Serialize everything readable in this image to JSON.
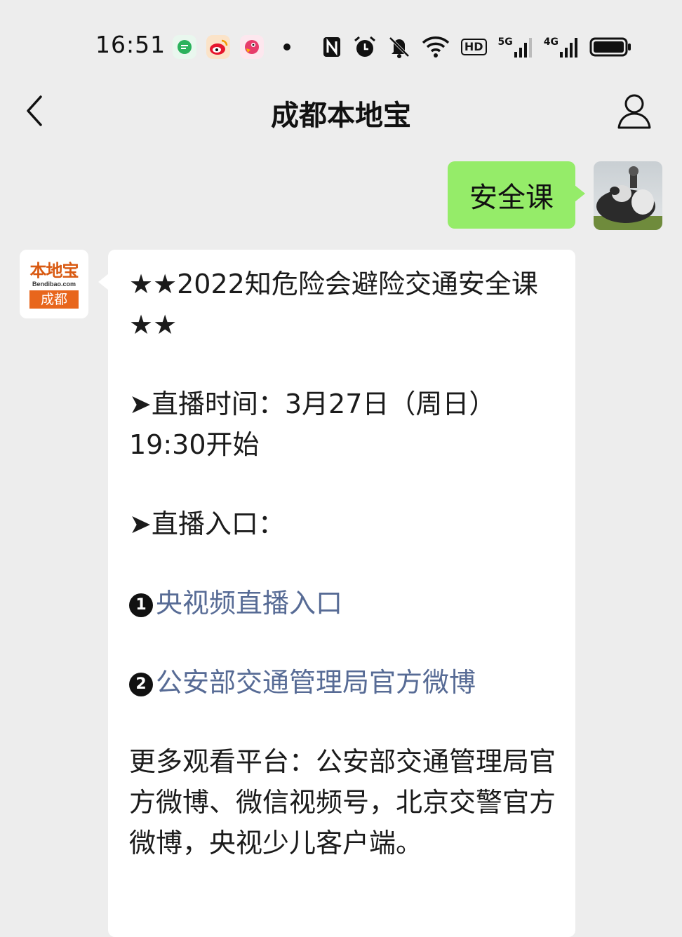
{
  "status_bar": {
    "time": "16:51",
    "app_icons": [
      "chat-bubble-icon",
      "weibo-icon",
      "bird-app-icon"
    ],
    "indicators": [
      "nfc-icon",
      "alarm-icon",
      "mute-icon",
      "wifi-icon",
      "hd-icon",
      "signal-5g-icon",
      "signal-4g-icon",
      "battery-icon"
    ],
    "hd_label": "HD",
    "net1": "5G",
    "net2": "4G"
  },
  "nav": {
    "title": "成都本地宝"
  },
  "outgoing_message": {
    "text": "安全课"
  },
  "bendibao_avatar": {
    "logo_top": "本地宝",
    "logo_mid": "Bendibao.com",
    "logo_city": "成都"
  },
  "incoming_message": {
    "title": "★★2022知危险会避险交通安全课★★",
    "live_time_label": "➤直播时间：3月27日（周日）19:30开始",
    "live_entry_label": "➤直播入口：",
    "link1_num": "1",
    "link1_text": "央视频直播入口",
    "link2_num": "2",
    "link2_text": "公安部交通管理局官方微博",
    "more_platforms": "更多观看平台：公安部交通管理局官方微博、微信视频号，北京交警官方微博，央视少儿客户端。"
  },
  "colors": {
    "background": "#ededed",
    "bubble_out": "#95ec69",
    "link": "#576b95",
    "brand_orange": "#e8661c"
  }
}
